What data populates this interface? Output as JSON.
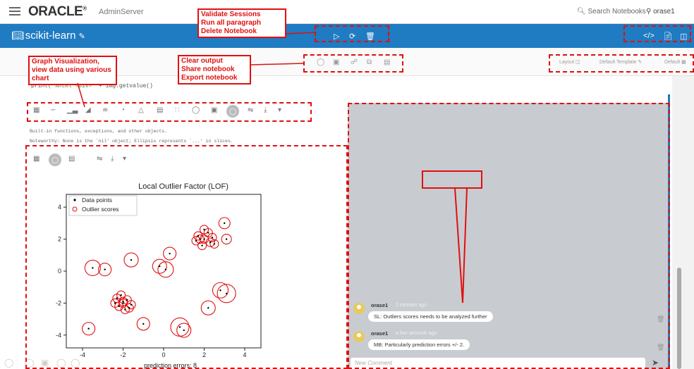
{
  "app": {
    "brand": "ORACLE",
    "brand_mark": "®",
    "sub": "AdminServer",
    "search_label": "Search Notebooks",
    "user": "orase1"
  },
  "notebook": {
    "title": "scikit-learn",
    "run_icons": [
      "play-icon",
      "refresh-icon",
      "trash-icon"
    ],
    "right_icons": [
      "code-icon",
      "document-icon",
      "panel-icon"
    ]
  },
  "options": {
    "layout": "Layout",
    "template": "Default Template",
    "default": "Default"
  },
  "cell": {
    "code_prefix": "print(",
    "code_string": "\"%html <div>\"",
    "code_rest": " + img.getvalue()",
    "output_line1": "Built-in functions, exceptions, and other objects.",
    "output_line2": "Noteworthy: None is the `nil' object; Ellipsis represents `...' in slices."
  },
  "chart_data": {
    "type": "scatter",
    "title": "Local Outlier Factor (LOF)",
    "xlabel": "prediction errors: 8",
    "ylabel": "",
    "xlim": [
      -4.8,
      4.8
    ],
    "ylim": [
      -4.8,
      4.8
    ],
    "x_ticks": [
      "-4",
      "-2",
      "0",
      "2",
      "4"
    ],
    "y_ticks": [
      "4",
      "2",
      "0",
      "-2",
      "-4"
    ],
    "x_tick_values": [
      -4,
      -2,
      0,
      2,
      4
    ],
    "y_tick_values": [
      4,
      2,
      0,
      -2,
      -4
    ],
    "legend": [
      "Data points",
      "Outlier scores"
    ],
    "legend_position": "top-left",
    "series": [
      {
        "name": "Data points",
        "color": "#000000",
        "points": [
          [
            2,
            2
          ],
          [
            1.7,
            2.2
          ],
          [
            2.3,
            1.8
          ],
          [
            1.9,
            1.6
          ],
          [
            2.2,
            2.4
          ],
          [
            1.6,
            1.9
          ],
          [
            2.4,
            2.1
          ],
          [
            2.0,
            2.6
          ],
          [
            1.8,
            2.0
          ],
          [
            2.5,
            1.7
          ],
          [
            -2,
            -2
          ],
          [
            -1.8,
            -1.8
          ],
          [
            -2.2,
            -2.2
          ],
          [
            -1.9,
            -2.4
          ],
          [
            -2.3,
            -1.7
          ],
          [
            -1.6,
            -2.1
          ],
          [
            -2.1,
            -1.5
          ],
          [
            -2.4,
            -2.0
          ],
          [
            -1.7,
            -2.3
          ],
          [
            -2.0,
            -1.9
          ],
          [
            3,
            3
          ],
          [
            3.1,
            2
          ],
          [
            -3.5,
            0.2
          ],
          [
            -2.9,
            0.1
          ],
          [
            -1.6,
            0.7
          ],
          [
            -0.2,
            0.3
          ],
          [
            0.3,
            1.1
          ],
          [
            0.1,
            0.1
          ],
          [
            -1.0,
            -3.3
          ],
          [
            2.8,
            -1.2
          ],
          [
            3.1,
            -1.4
          ],
          [
            2.2,
            -2.3
          ],
          [
            0.8,
            -3.5
          ],
          [
            1.0,
            -3.7
          ],
          [
            -3.7,
            -3.6
          ]
        ]
      },
      {
        "name": "Outlier scores",
        "color": "#e01010",
        "points": [
          [
            2,
            2,
            6
          ],
          [
            1.7,
            2.2,
            6
          ],
          [
            2.3,
            1.8,
            6
          ],
          [
            1.9,
            1.6,
            6
          ],
          [
            2.2,
            2.4,
            6
          ],
          [
            1.6,
            1.9,
            6
          ],
          [
            2.4,
            2.1,
            6
          ],
          [
            2.0,
            2.6,
            6
          ],
          [
            1.8,
            2.0,
            6
          ],
          [
            2.5,
            1.7,
            6
          ],
          [
            -2,
            -2,
            6
          ],
          [
            -1.8,
            -1.8,
            6
          ],
          [
            -2.2,
            -2.2,
            6
          ],
          [
            -1.9,
            -2.4,
            6
          ],
          [
            -2.3,
            -1.7,
            6
          ],
          [
            -1.6,
            -2.1,
            6
          ],
          [
            -2.1,
            -1.5,
            6
          ],
          [
            -2.4,
            -2.0,
            6
          ],
          [
            -1.7,
            -2.3,
            6
          ],
          [
            -2.0,
            -1.9,
            6
          ],
          [
            3,
            3,
            8
          ],
          [
            3.1,
            2,
            7
          ],
          [
            -3.5,
            0.2,
            11
          ],
          [
            -2.9,
            0.1,
            9
          ],
          [
            -1.6,
            0.7,
            10
          ],
          [
            -0.2,
            0.3,
            10
          ],
          [
            0.3,
            1.1,
            9
          ],
          [
            0.1,
            0.1,
            11
          ],
          [
            -1.0,
            -3.3,
            9
          ],
          [
            2.8,
            -1.2,
            11
          ],
          [
            3.1,
            -1.4,
            13
          ],
          [
            2.2,
            -2.3,
            10
          ],
          [
            0.8,
            -3.5,
            13
          ],
          [
            1.0,
            -3.7,
            10
          ],
          [
            -3.7,
            -3.6,
            9
          ]
        ]
      }
    ]
  },
  "comments": [
    {
      "user": "orase1",
      "time": "2 minutes ago",
      "text": "SL: Outliers scores needs to be analyzed further"
    },
    {
      "user": "orase1",
      "time": "a few seconds ago",
      "text": "MB: Particularly prediction errors +/- 2."
    }
  ],
  "comment_placeholder": "New Comment",
  "annotations": {
    "validate": [
      "Validate Sessions",
      "Run all paragraph",
      "Delete Notebook"
    ],
    "clear": [
      "Clear output",
      "Share notebook",
      "Export notebook"
    ],
    "graph": [
      "Graph Visualization,",
      "view data using various",
      "chart"
    ]
  },
  "colors": {
    "header_blue": "#1f7bc2",
    "annotation_red": "#e01010",
    "panel_gray": "#c8ccd1"
  }
}
